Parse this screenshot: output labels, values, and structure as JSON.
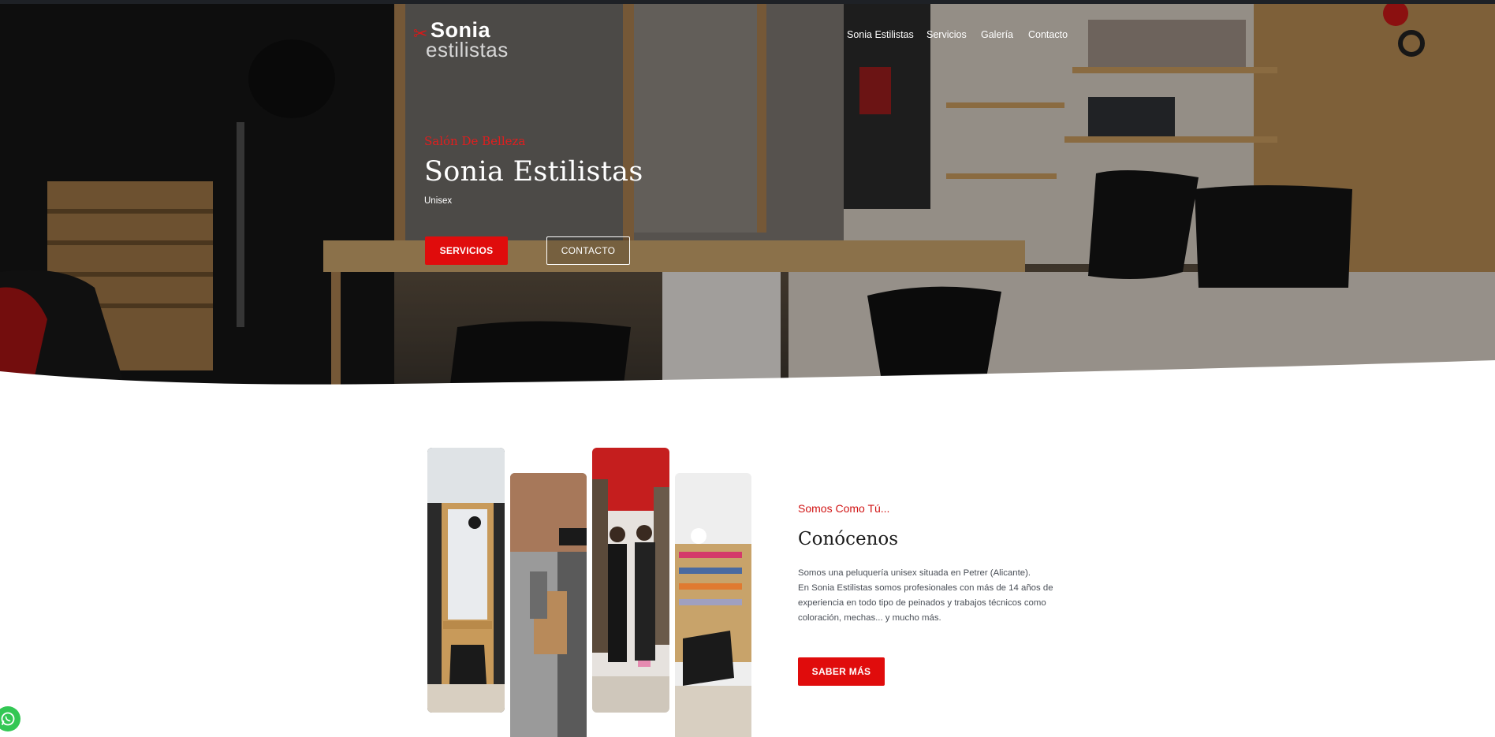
{
  "logo": {
    "line1": "Sonia",
    "line2": "estilistas"
  },
  "nav": [
    {
      "label": "Sonia Estilistas"
    },
    {
      "label": "Servicios"
    },
    {
      "label": "Galería"
    },
    {
      "label": "Contacto"
    }
  ],
  "hero": {
    "subtitle": "Salón De Belleza",
    "title": "Sonia Estilistas",
    "tagline": "Unisex",
    "primary_button": "SERVICIOS",
    "secondary_button": "CONTACTO"
  },
  "about": {
    "subtitle": "Somos Como Tú...",
    "title": "Conócenos",
    "paragraphs": [
      "Somos una peluquería unisex situada en Petrer (Alicante).",
      "En Sonia Estilistas somos profesionales con más de 14 años de experiencia en todo tipo de peinados y trabajos técnicos como coloración, mechas... y mucho más."
    ],
    "button": "SABER MÁS"
  },
  "icons": {
    "scissors": "scissors-icon",
    "whatsapp": "whatsapp-icon"
  },
  "colors": {
    "accent": "#e00c0c",
    "hero_overlay": "#000000",
    "text_dark": "#1b1b1b",
    "text_body": "#4a4f57",
    "whatsapp": "#33c754"
  }
}
